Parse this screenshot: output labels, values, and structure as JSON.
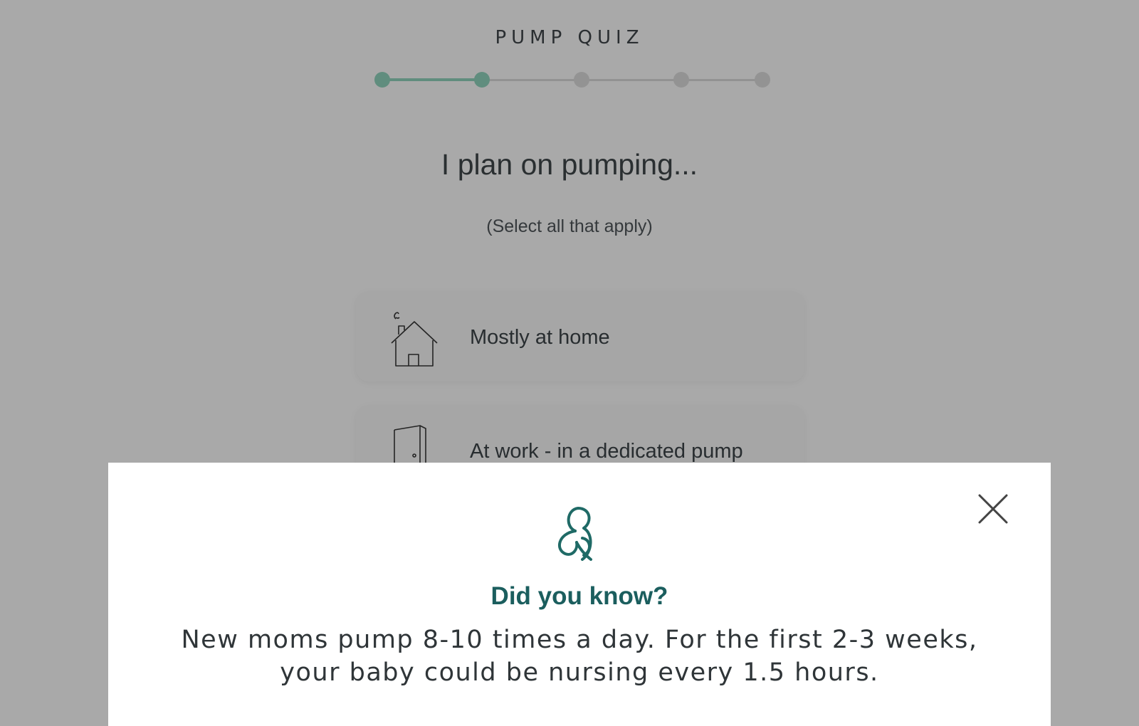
{
  "quiz": {
    "title": "PUMP QUIZ",
    "progress": {
      "current_step": 2,
      "total_steps": 5
    }
  },
  "question": {
    "text": "I plan on pumping...",
    "instruction": "(Select all that apply)"
  },
  "options": [
    {
      "label": "Mostly at home",
      "icon": "house-icon"
    },
    {
      "label": "At work - in a dedicated pump",
      "icon": "door-icon"
    }
  ],
  "modal": {
    "icon": "mother-baby-leaf-logo-icon",
    "heading": "Did you know?",
    "body": "New moms pump 8-10 times a day. For the first 2-3 weeks, your baby could be nursing every 1.5 hours.",
    "close_icon": "close-icon"
  },
  "colors": {
    "accent": "#8fd4bd",
    "heading_teal": "#1b5e5e",
    "text_dark": "#3d4448",
    "overlay": "rgba(8,8,8,0.35)"
  }
}
